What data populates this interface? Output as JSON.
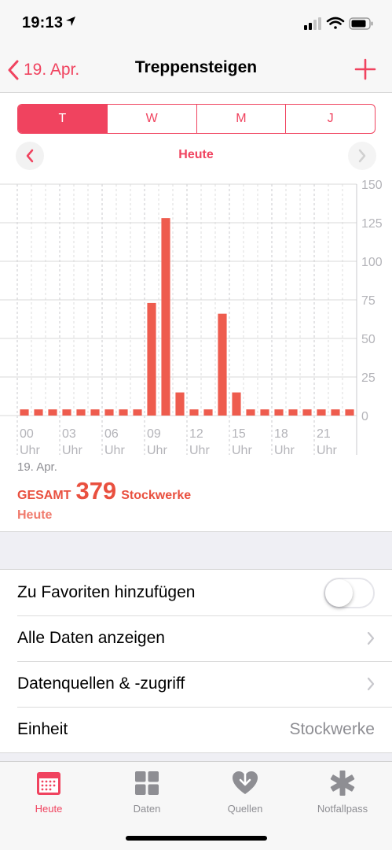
{
  "status_bar": {
    "time": "19:13"
  },
  "nav": {
    "back_label": "19. Apr.",
    "title": "Treppensteigen"
  },
  "segments": [
    {
      "label": "T",
      "active": true
    },
    {
      "label": "W",
      "active": false
    },
    {
      "label": "M",
      "active": false
    },
    {
      "label": "J",
      "active": false
    }
  ],
  "period": {
    "label": "Heute"
  },
  "chart_data": {
    "type": "bar",
    "x": [
      0,
      1,
      2,
      3,
      4,
      5,
      6,
      7,
      8,
      9,
      10,
      11,
      12,
      13,
      14,
      15,
      16,
      17,
      18,
      19,
      20,
      21,
      22,
      23
    ],
    "x_tick_labels": [
      {
        "hour": "00",
        "unit": "Uhr"
      },
      {
        "hour": "03",
        "unit": "Uhr"
      },
      {
        "hour": "06",
        "unit": "Uhr"
      },
      {
        "hour": "09",
        "unit": "Uhr"
      },
      {
        "hour": "12",
        "unit": "Uhr"
      },
      {
        "hour": "15",
        "unit": "Uhr"
      },
      {
        "hour": "18",
        "unit": "Uhr"
      },
      {
        "hour": "21",
        "unit": "Uhr"
      }
    ],
    "values": [
      4,
      4,
      4,
      4,
      4,
      4,
      4,
      4,
      4,
      73,
      128,
      15,
      4,
      4,
      66,
      15,
      4,
      4,
      4,
      4,
      4,
      4,
      4,
      4
    ],
    "ylim": [
      0,
      150
    ],
    "y_ticks": [
      0,
      25,
      50,
      75,
      100,
      125,
      150
    ],
    "color": "#ee5c4e",
    "grid": true
  },
  "summary": {
    "date": "19. Apr.",
    "total_prefix": "GESAMT",
    "total_value": "379",
    "total_unit": "Stockwerke",
    "subtitle": "Heute"
  },
  "settings": {
    "favorites_label": "Zu Favoriten hinzufügen",
    "favorites_on": false,
    "all_data_label": "Alle Daten anzeigen",
    "sources_label": "Datenquellen & -zugriff",
    "unit_label": "Einheit",
    "unit_value": "Stockwerke"
  },
  "tabs": [
    {
      "label": "Heute",
      "icon": "calendar-icon",
      "active": true
    },
    {
      "label": "Daten",
      "icon": "grid-icon",
      "active": false
    },
    {
      "label": "Quellen",
      "icon": "heart-download-icon",
      "active": false
    },
    {
      "label": "Notfallpass",
      "icon": "asterisk-icon",
      "active": false
    }
  ],
  "colors": {
    "accent": "#f0435f",
    "bar": "#ee5c4e",
    "total": "#e9503f"
  }
}
